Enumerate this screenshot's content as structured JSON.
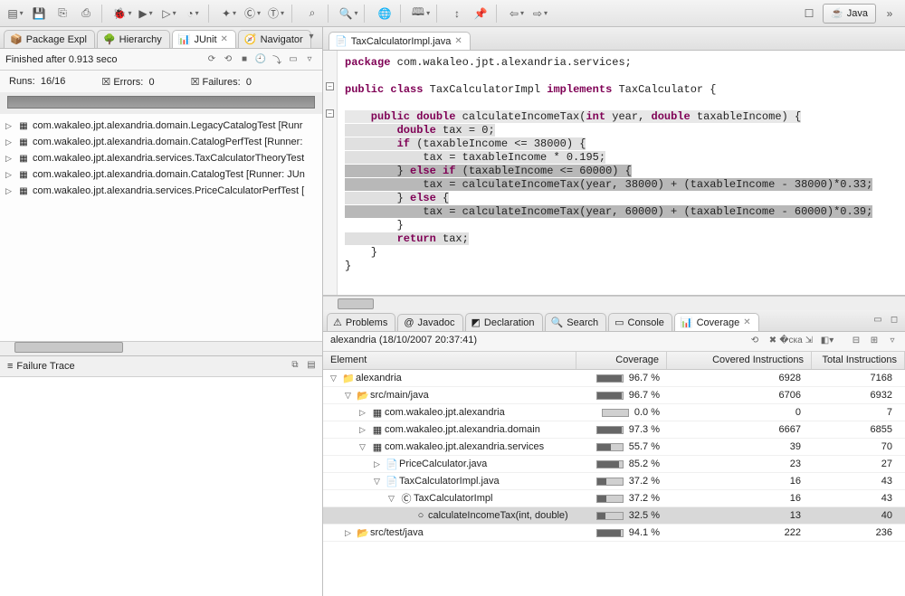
{
  "perspective": {
    "java_label": "Java"
  },
  "left": {
    "tabs": {
      "pkg": "Package Expl",
      "hierarchy": "Hierarchy",
      "junit": "JUnit",
      "navigator": "Navigator"
    },
    "junit": {
      "finished_label": "Finished after 0.913 seco",
      "runs_label": "Runs:",
      "runs_value": "16/16",
      "errors_label": "Errors:",
      "errors_value": "0",
      "failures_label": "Failures:",
      "failures_value": "0",
      "tests": [
        "com.wakaleo.jpt.alexandria.domain.LegacyCatalogTest [Runr",
        "com.wakaleo.jpt.alexandria.domain.CatalogPerfTest [Runner:",
        "com.wakaleo.jpt.alexandria.services.TaxCalculatorTheoryTest",
        "com.wakaleo.jpt.alexandria.domain.CatalogTest [Runner: JUn",
        "com.wakaleo.jpt.alexandria.services.PriceCalculatorPerfTest ["
      ],
      "failure_trace_label": "Failure Trace"
    }
  },
  "editor": {
    "tab_title": "TaxCalculatorImpl.java",
    "code": {
      "l1a": "package",
      "l1b": " com.wakaleo.jpt.alexandria.services;",
      "l2a": "public",
      "l2b": " class",
      "l2c": " TaxCalculatorImpl ",
      "l2d": "implements",
      "l2e": " TaxCalculator {",
      "l3a": "    public",
      "l3b": " double",
      "l3c": " calculateIncomeTax(",
      "l3d": "int",
      "l3e": " year, ",
      "l3f": "double",
      "l3g": " taxableIncome) {",
      "l4a": "        double",
      "l4b": " tax = 0;",
      "l5a": "        if",
      "l5b": " (taxableIncome <= 38000) {",
      "l6": "            tax = taxableIncome * 0.195;",
      "l7a": "        } ",
      "l7b": "else",
      "l7c": " if",
      "l7d": " (taxableIncome <= 60000) {",
      "l8": "            tax = calculateIncomeTax(year, 38000) + (taxableIncome - 38000)*0.33;",
      "l9a": "        } ",
      "l9b": "else",
      "l9c": " {",
      "l10": "            tax = calculateIncomeTax(year, 60000) + (taxableIncome - 60000)*0.39;",
      "l11": "        }",
      "l12a": "        return",
      "l12b": " tax;",
      "l13": "    }",
      "l14": "}"
    }
  },
  "bottom": {
    "tabs": {
      "problems": "Problems",
      "javadoc": "Javadoc",
      "declaration": "Declaration",
      "search": "Search",
      "console": "Console",
      "coverage": "Coverage"
    },
    "coverage": {
      "session_label": "alexandria (18/10/2007 20:37:41)",
      "headers": {
        "element": "Element",
        "coverage": "Coverage",
        "covered": "Covered Instructions",
        "total": "Total Instructions"
      },
      "rows": [
        {
          "indent": 0,
          "toggle": "▽",
          "icon": "📁",
          "name": "alexandria",
          "pct": "96.7 %",
          "bar": 96.7,
          "ci": "6928",
          "ti": "7168",
          "sel": false
        },
        {
          "indent": 1,
          "toggle": "▽",
          "icon": "📂",
          "name": "src/main/java",
          "pct": "96.7 %",
          "bar": 96.7,
          "ci": "6706",
          "ti": "6932",
          "sel": false
        },
        {
          "indent": 2,
          "toggle": "▷",
          "icon": "▦",
          "name": "com.wakaleo.jpt.alexandria",
          "pct": "0.0 %",
          "bar": 0,
          "ci": "0",
          "ti": "7",
          "sel": false
        },
        {
          "indent": 2,
          "toggle": "▷",
          "icon": "▦",
          "name": "com.wakaleo.jpt.alexandria.domain",
          "pct": "97.3 %",
          "bar": 97.3,
          "ci": "6667",
          "ti": "6855",
          "sel": false
        },
        {
          "indent": 2,
          "toggle": "▽",
          "icon": "▦",
          "name": "com.wakaleo.jpt.alexandria.services",
          "pct": "55.7 %",
          "bar": 55.7,
          "ci": "39",
          "ti": "70",
          "sel": false
        },
        {
          "indent": 3,
          "toggle": "▷",
          "icon": "📄",
          "name": "PriceCalculator.java",
          "pct": "85.2 %",
          "bar": 85.2,
          "ci": "23",
          "ti": "27",
          "sel": false
        },
        {
          "indent": 3,
          "toggle": "▽",
          "icon": "📄",
          "name": "TaxCalculatorImpl.java",
          "pct": "37.2 %",
          "bar": 37.2,
          "ci": "16",
          "ti": "43",
          "sel": false
        },
        {
          "indent": 4,
          "toggle": "▽",
          "icon": "Ⓒ",
          "name": "TaxCalculatorImpl",
          "pct": "37.2 %",
          "bar": 37.2,
          "ci": "16",
          "ti": "43",
          "sel": false
        },
        {
          "indent": 5,
          "toggle": "",
          "icon": "○",
          "name": "calculateIncomeTax(int, double)",
          "pct": "32.5 %",
          "bar": 32.5,
          "ci": "13",
          "ti": "40",
          "sel": true
        },
        {
          "indent": 1,
          "toggle": "▷",
          "icon": "📂",
          "name": "src/test/java",
          "pct": "94.1 %",
          "bar": 94.1,
          "ci": "222",
          "ti": "236",
          "sel": false
        }
      ]
    }
  }
}
